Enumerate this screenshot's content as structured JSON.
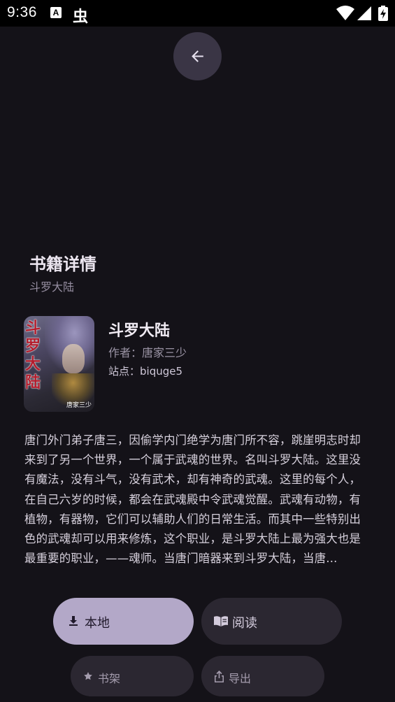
{
  "status_bar": {
    "time": "9:36",
    "notification_icons": [
      "a-letter-icon",
      "bug-icon"
    ],
    "system_icons": [
      "wifi-icon",
      "signal-icon",
      "battery-icon"
    ]
  },
  "header": {
    "back_icon": "arrow-left-icon"
  },
  "section": {
    "title": "书籍详情",
    "subtitle": "斗罗大陆"
  },
  "book": {
    "cover_title": "斗罗大陆",
    "cover_author": "唐家三少",
    "title": "斗罗大陆",
    "author": "作者：唐家三少",
    "site": "站点：biquge5",
    "description": "唐门外门弟子唐三，因偷学内门绝学为唐门所不容，跳崖明志时却来到了另一个世界，一个属于武魂的世界。名叫斗罗大陆。这里没有魔法，没有斗气，没有武术，却有神奇的武魂。这里的每个人，在自己六岁的时候，都会在武魂殿中令武魂觉醒。武魂有动物，有植物，有器物，它们可以辅助人们的日常生活。而其中一些特别出色的武魂却可以用来修炼，这个职业，是斗罗大陆上最为强大也是最重要的职业，——魂师。当唐门暗器来到斗罗大陆，当唐..."
  },
  "actions": {
    "local": {
      "label": "本地",
      "icon": "download-icon"
    },
    "read": {
      "label": "阅读",
      "icon": "book-open-icon"
    },
    "shelf": {
      "label": "书架",
      "icon": "star-icon"
    },
    "export": {
      "label": "导出",
      "icon": "share-icon"
    }
  },
  "colors": {
    "background": "#141218",
    "primary_button": "#b3a8c8",
    "tonal_button": "#2b2731"
  }
}
